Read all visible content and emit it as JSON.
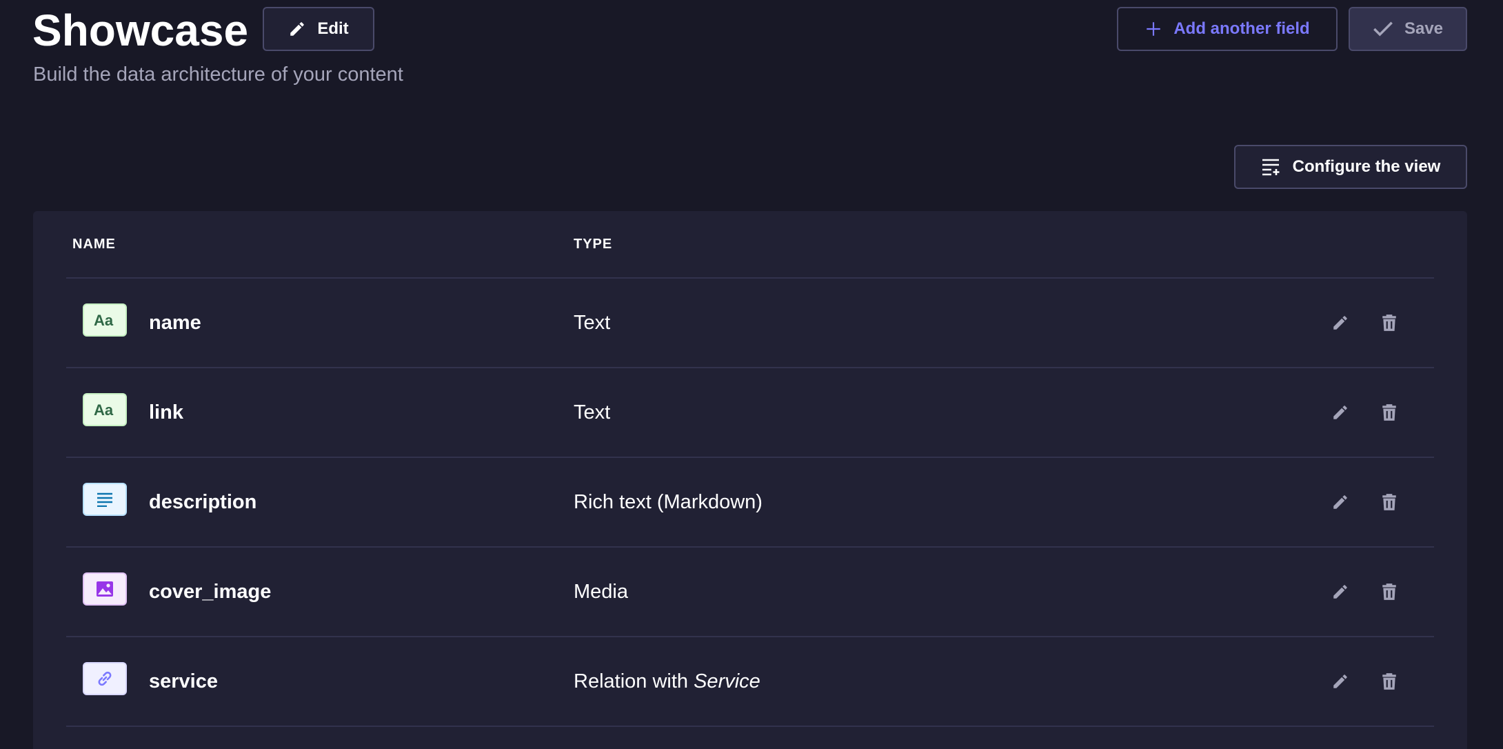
{
  "header": {
    "title": "Showcase",
    "subtitle": "Build the data architecture of your content",
    "edit_label": "Edit",
    "add_field_label": "Add another field",
    "save_label": "Save",
    "configure_label": "Configure the view"
  },
  "table": {
    "columns": {
      "name": "NAME",
      "type": "TYPE"
    },
    "rows": [
      {
        "name": "name",
        "type": "Text",
        "icon": "text-icon"
      },
      {
        "name": "link",
        "type": "Text",
        "icon": "text-icon"
      },
      {
        "name": "description",
        "type": "Rich text (Markdown)",
        "icon": "richtext-icon"
      },
      {
        "name": "cover_image",
        "type": "Media",
        "icon": "media-icon"
      },
      {
        "name": "service",
        "type_prefix": "Relation with",
        "type_target": "Service",
        "icon": "relation-icon"
      }
    ]
  },
  "colors": {
    "background": "#181826",
    "surface": "#212134",
    "border": "#4a4a6a",
    "accent": "#7b79ff",
    "muted_text": "#a5a5ba"
  }
}
